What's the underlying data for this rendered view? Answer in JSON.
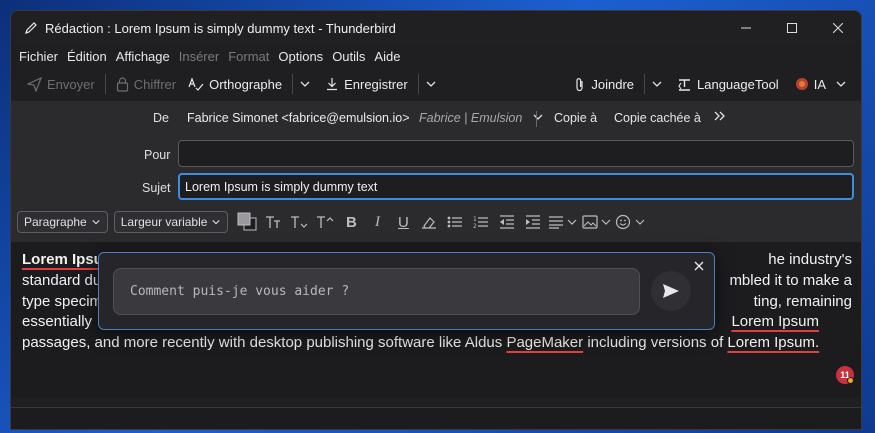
{
  "window": {
    "title": "Rédaction : Lorem Ipsum is simply dummy text - Thunderbird"
  },
  "menu": {
    "items": [
      "Fichier",
      "Édition",
      "Affichage",
      "Insérer",
      "Format",
      "Options",
      "Outils",
      "Aide"
    ],
    "disabled": [
      3,
      4
    ]
  },
  "toolbar": {
    "send_label": "Envoyer",
    "encrypt_label": "Chiffrer",
    "spell_label": "Orthographe",
    "save_label": "Enregistrer",
    "attach_label": "Joindre",
    "languagetool_label": "LanguageTool",
    "ai_label": "IA"
  },
  "header": {
    "from_label": "De",
    "from_value": "Fabrice Simonet <fabrice@emulsion.io>",
    "from_identity": "Fabrice | Emulsion",
    "cc_label": "Copie à",
    "bcc_label": "Copie cachée à",
    "to_label": "Pour",
    "to_value": "",
    "subject_label": "Sujet",
    "subject_value": "Lorem Ipsum is simply dummy text"
  },
  "format": {
    "paragraph_label": "Paragraphe",
    "font_label": "Largeur variable"
  },
  "body": {
    "line1_a": "Lorem Ipsum",
    "line1_b": "he industry's",
    "line2_a": "standard du",
    "line2_b": "mbled it to make a",
    "line3_a": "type specim",
    "line3_b": "ting, remaining",
    "line4_a": "essentially",
    "line4_b": "Lorem Ipsum",
    "line5": "passages, and more recently with desktop publishing software like Aldus",
    "pagemaker": "PageMaker",
    "line5_c": "including versions of",
    "lorem_end": "Lorem Ipsum."
  },
  "ai": {
    "placeholder": "Comment puis-je vous aider ?"
  },
  "badge": {
    "count": "11"
  }
}
